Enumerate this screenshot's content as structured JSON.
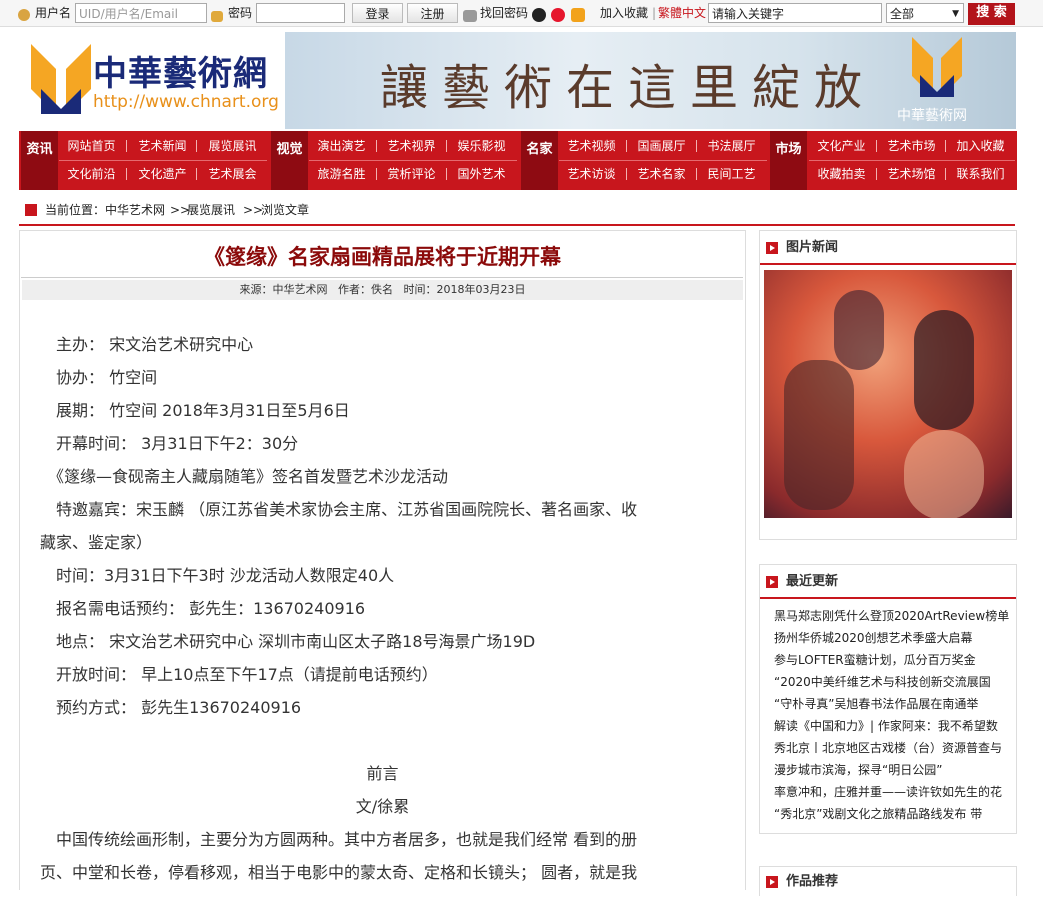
{
  "topbar": {
    "username_label": "用户名",
    "username_placeholder": "UID/用户名/Email",
    "password_label": "密码",
    "login": "登录",
    "register": "注册",
    "forgot": "找回密码",
    "bookmark": "加入收藏",
    "lang": "繁體中文",
    "search_placeholder": "请输入关键字",
    "scope": "全部",
    "search_btn": "搜 索"
  },
  "logo": {
    "name": "中華藝術網",
    "url": "http://www.chnart.org"
  },
  "banner": {
    "slogan": "讓藝術在這里綻放",
    "mark": "中華藝術网"
  },
  "nav": {
    "groups": [
      {
        "cat": "资讯",
        "row1": [
          "网站首页",
          "艺术新闻",
          "展览展讯"
        ],
        "row2": [
          "文化前沿",
          "文化遗产",
          "艺术展会"
        ]
      },
      {
        "cat": "视觉",
        "row1": [
          "演出演艺",
          "艺术视界",
          "娱乐影视"
        ],
        "row2": [
          "旅游名胜",
          "赏析评论",
          "国外艺术"
        ]
      },
      {
        "cat": "名家",
        "row1": [
          "艺术视频",
          "国画展厅",
          "书法展厅"
        ],
        "row2": [
          "艺术访谈",
          "艺术名家",
          "民间工艺"
        ]
      },
      {
        "cat": "市场",
        "row1": [
          "文化产业",
          "艺术市场",
          "加入收藏"
        ],
        "row2": [
          "收藏拍卖",
          "艺术场馆",
          "联系我们"
        ]
      }
    ]
  },
  "breadcrumb": {
    "prefix": "当前位置：",
    "items": [
      "中华艺术网",
      "展览展讯",
      "浏览文章"
    ],
    "sep": ">>"
  },
  "article": {
    "title": "《篴缘》名家扇画精品展将于近期开幕",
    "meta": "来源：中华艺术网   作者：佚名   时间：2018年03月23日",
    "lines": [
      "　主办：  宋文治艺术研究中心",
      "　协办：  竹空间",
      "　展期：  竹空间 2018年3月31日至5月6日",
      "　开幕时间：   3月31日下午2：30分",
      "　《篴缘—食砚斋主人藏扇随笔》签名首发暨艺术沙龙活动",
      "　特邀嘉宾：宋玉麟 （原江苏省美术家协会主席、江苏省国画院院长、著名画家、收",
      "藏家、鉴定家）",
      "　时间：3月31日下午3时 沙龙活动人数限定40人",
      "　报名需电话预约：  彭先生：13670240916",
      "　地点：  宋文治艺术研究中心 深圳市南山区太子路18号海景广场19D",
      "　开放时间：  早上10点至下午17点（请提前电话预约）",
      "　预约方式：  彭先生13670240916"
    ],
    "preface_title": "前言",
    "preface_author": "文/徐累",
    "body": [
      "　中国传统绘画形制，主要分为方圆两种。其中方者居多，也就是我们经常 看到的册",
      "页、中堂和长卷，停看移观，相当于电影中的蒙太奇、定格和长镜头；  圆者，就是我"
    ]
  },
  "sidebar": {
    "photo_news_title": "图片新闻",
    "latest_title": "最近更新",
    "latest": [
      "黑马郑志刚凭什么登顶2020ArtReview榜单",
      "扬州华侨城2020创想艺术季盛大启幕",
      "参与LOFTER蛮糖计划，瓜分百万奖金",
      "“2020中美纤维艺术与科技创新交流展国",
      "“守朴寻真”吴旭春书法作品展在南通举",
      "解读《中国和力》| 作家阿来：我不希望数",
      "秀北京丨北京地区古戏楼（台）资源普查与",
      "漫步城市滨海，探寻“明日公园”",
      "率意冲和，庄雅并重——读许钦如先生的花",
      "“秀北京”戏剧文化之旅精品路线发布 带"
    ],
    "works_title": "作品推荐"
  }
}
